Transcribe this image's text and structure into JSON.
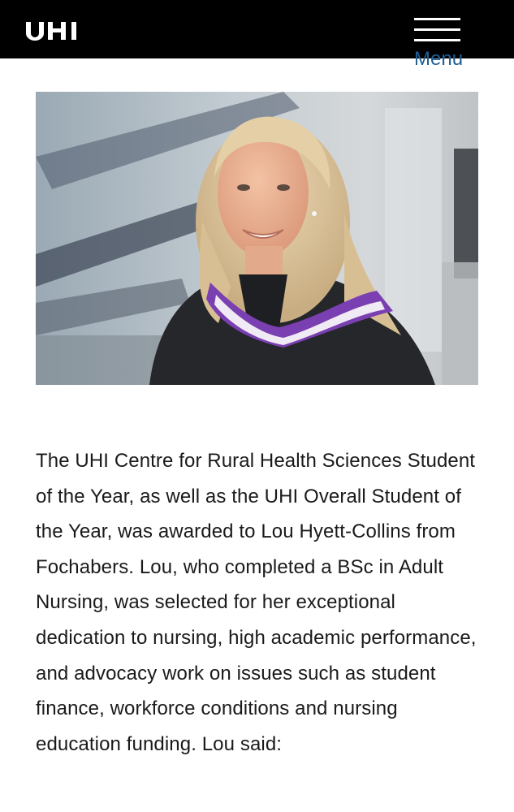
{
  "header": {
    "logo_text": "UHI",
    "menu_label": "Menu"
  },
  "hero_image": {
    "icon": "graduate-portrait-photo"
  },
  "article": {
    "paragraph": "The UHI Centre for Rural Health Sciences Student of the Year, as well as the UHI Overall Student of the Year, was awarded to Lou Hyett-Collins from Fochabers. Lou, who completed a BSc in Adult Nursing, was selected for her exceptional dedication to nursing, high academic performance, and advocacy work on issues such as student finance, workforce conditions and nursing education funding. Lou said:"
  },
  "colors": {
    "header_bg": "#000000",
    "menu_link": "#1f5e95",
    "text": "#1a1a1a",
    "hood_purple": "#7a3fb0"
  }
}
